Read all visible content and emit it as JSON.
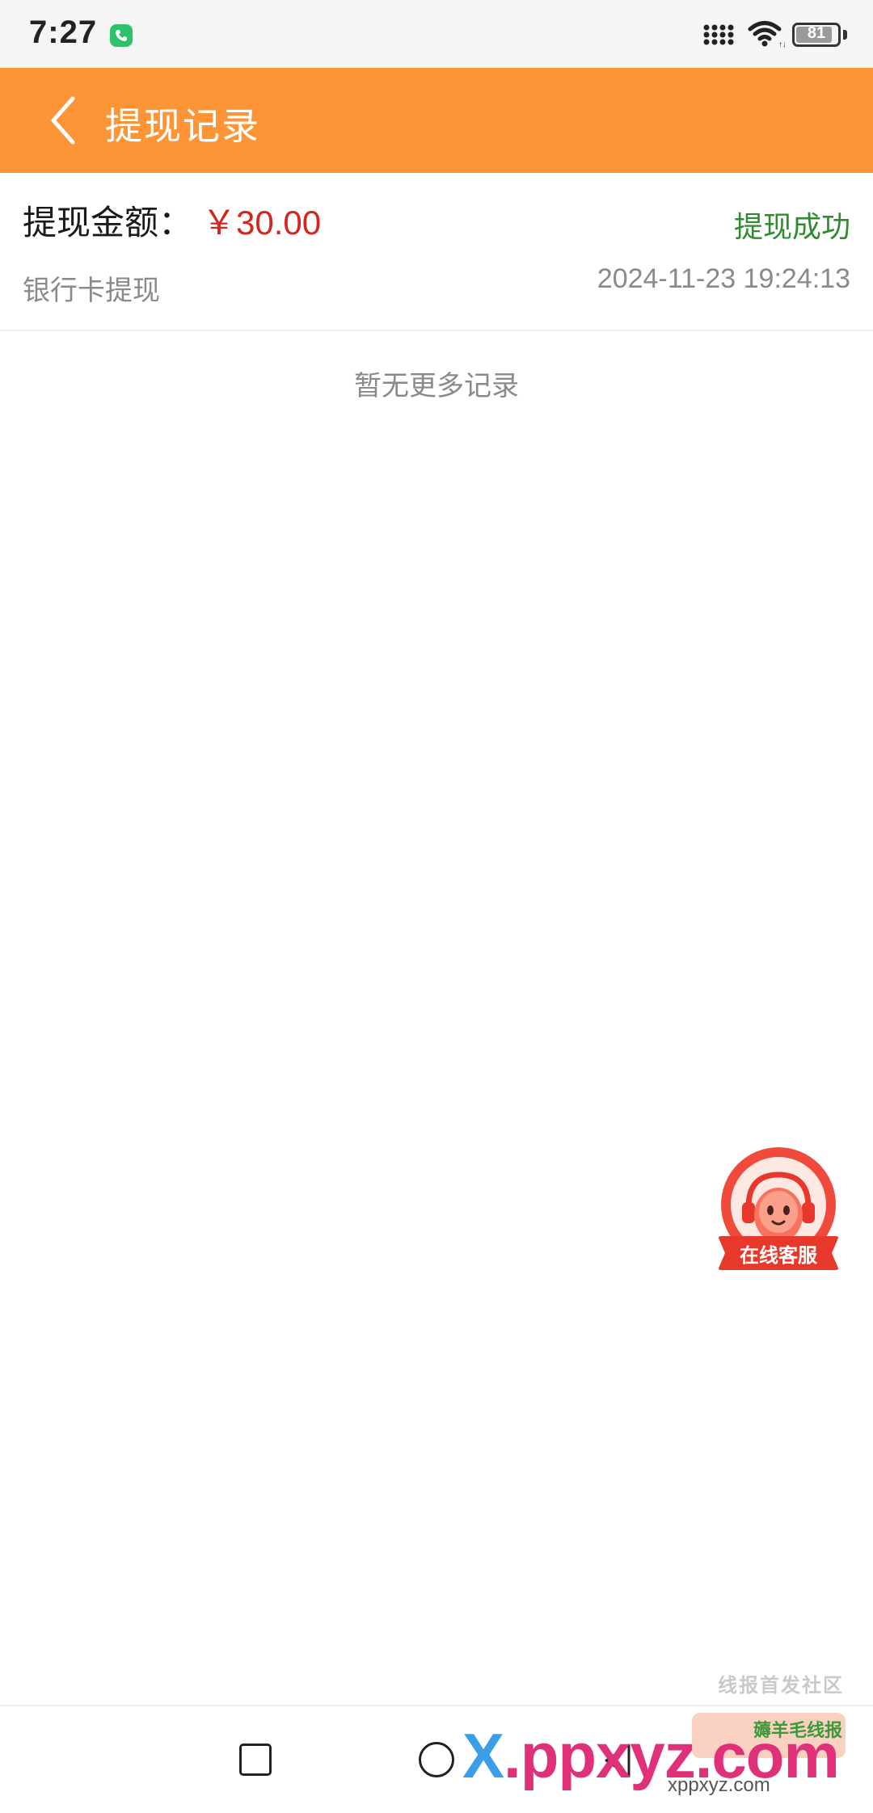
{
  "status_bar": {
    "time": "7:27",
    "battery_level": "81",
    "icons": [
      "phone-call-icon",
      "signal-icon",
      "wifi-icon",
      "battery-icon"
    ]
  },
  "header": {
    "title": "提现记录",
    "back_icon": "back-chevron-icon",
    "color": "#fd9536"
  },
  "records": [
    {
      "amount_label": "提现金额：",
      "amount": "￥30.00",
      "status": "提现成功",
      "method": "银行卡提现",
      "datetime": "2024-11-23 19:24:13"
    }
  ],
  "list_footer": "暂无更多记录",
  "floating_service": {
    "label": "在线客服"
  },
  "nav_bar": {
    "icons": [
      "recents-square-icon",
      "home-circle-icon",
      "back-triangle-icon"
    ]
  },
  "watermark": {
    "top_text": "线报首发社区",
    "main_x": "X",
    "main_rest": ".ppxyz.com",
    "app_text": "薅羊毛线报",
    "bottom_text": "xppxyz.com"
  },
  "colors": {
    "accent": "#fd9536",
    "amount": "#d4261f",
    "success": "#2e8b2e",
    "muted": "#8a8a8a"
  }
}
